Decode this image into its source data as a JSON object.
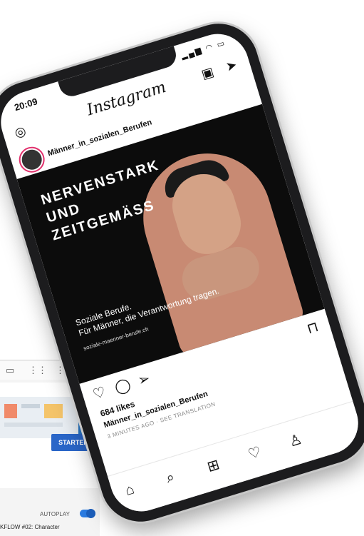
{
  "background_app": {
    "toolbar_icons": [
      "video-icon",
      "grid-icon",
      "more-vertical-icon"
    ],
    "start_button": "STARTEN",
    "autoplay_label": "AUTOPLAY",
    "workflow_text": "KFLOW #02: Character"
  },
  "phone": {
    "status_time": "20:09",
    "status_icons": "▂▄▆ ◠ ▭",
    "app_name": "Instagram",
    "post": {
      "username": "Männer_in_sozialen_Berufen",
      "headline_line1": "NERVENSTARK",
      "headline_line2": "UND",
      "headline_line3": "ZEITGEMÄSS",
      "image_caption_line1": "Soziale Berufe.",
      "image_caption_line2": "Für Männer, die Verantwortung tragen.",
      "image_url_text": "soziale-maenner-berufe.ch",
      "likes": "684 likes",
      "caption_username": "Männer_in_sozialen_Berufen",
      "time_ago": "3 MINUTES AGO",
      "see_translation": "SEE TRANSLATION"
    }
  },
  "colors": {
    "start_button": "#2a66c8",
    "toggle": "#2a7be0",
    "story_ring": "#e1306c",
    "hoodie": "#c88a73"
  }
}
